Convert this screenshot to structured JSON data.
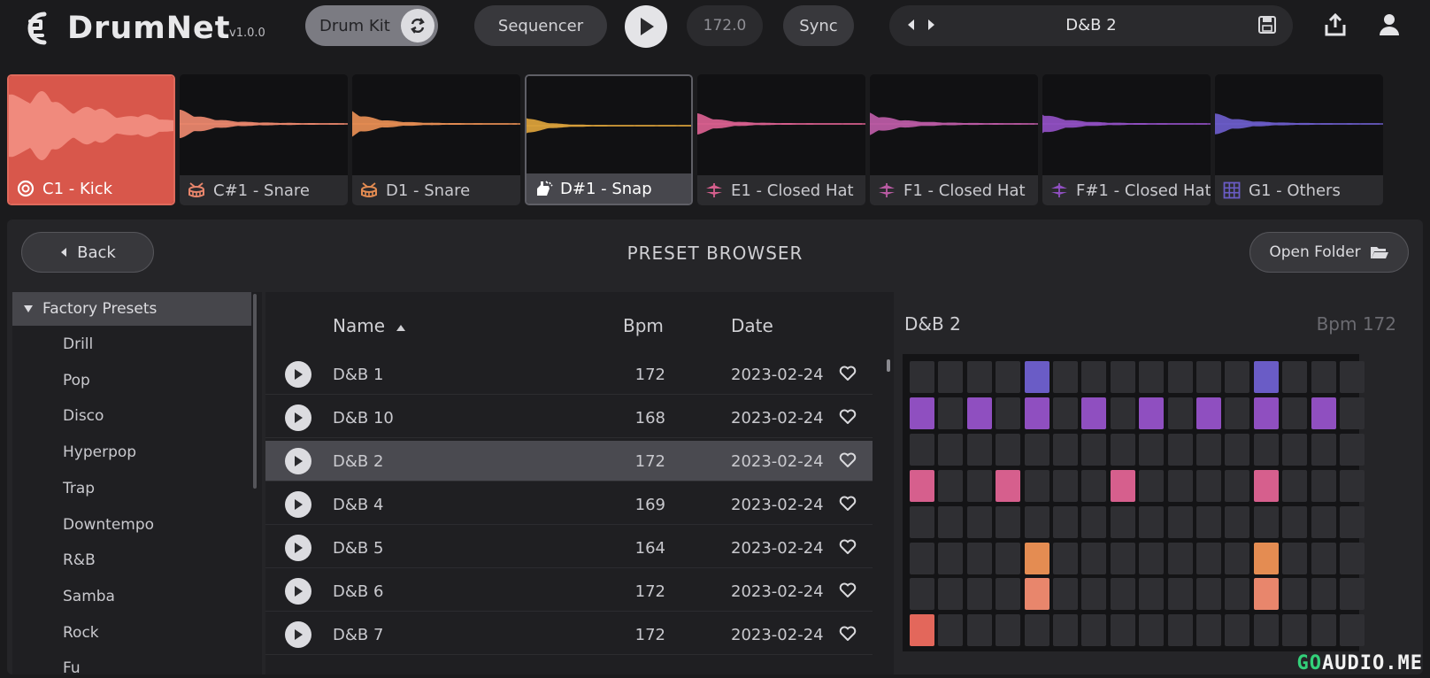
{
  "header": {
    "brand": "DrumNet",
    "version": "v1.0.0",
    "drum_kit_label": "Drum Kit",
    "sequencer_label": "Sequencer",
    "bpm": "172.0",
    "sync_label": "Sync",
    "preset_name": "D&B 2"
  },
  "pads": [
    {
      "label": "C1 - Kick",
      "color": "#e3675b",
      "icon": "kick-drum-icon",
      "state": "active"
    },
    {
      "label": "C#1 - Snare",
      "color": "#e8866c",
      "icon": "snare-drum-icon",
      "state": "normal"
    },
    {
      "label": "D1 - Snare",
      "color": "#e48c52",
      "icon": "snare-drum-icon",
      "state": "normal"
    },
    {
      "label": "D#1 - Snap",
      "color": "#d9a03a",
      "icon": "snap-hand-icon",
      "state": "selected"
    },
    {
      "label": "E1 - Closed Hat",
      "color": "#d65f8d",
      "icon": "hi-hat-icon",
      "state": "normal"
    },
    {
      "label": "F1 - Closed Hat",
      "color": "#b95ba3",
      "icon": "hi-hat-icon",
      "state": "normal"
    },
    {
      "label": "F#1 - Closed Hat",
      "color": "#8f4fc0",
      "icon": "hi-hat-icon",
      "state": "normal"
    },
    {
      "label": "G1 - Others",
      "color": "#6a5cc6",
      "icon": "grid-icon",
      "state": "normal"
    }
  ],
  "browser": {
    "back_label": "Back",
    "title": "PRESET BROWSER",
    "open_folder_label": "Open Folder"
  },
  "tree": {
    "root": "Factory Presets",
    "items": [
      "Drill",
      "Pop",
      "Disco",
      "Hyperpop",
      "Trap",
      "Downtempo",
      "R&B",
      "Samba",
      "Rock",
      "Fu"
    ]
  },
  "list": {
    "columns": {
      "name": "Name",
      "bpm": "Bpm",
      "date": "Date"
    },
    "sort": "name-ascending",
    "rows": [
      {
        "name": "D&B 1",
        "bpm": "172",
        "date": "2023-02-24",
        "selected": false
      },
      {
        "name": "D&B 10",
        "bpm": "168",
        "date": "2023-02-24",
        "selected": false
      },
      {
        "name": "D&B 2",
        "bpm": "172",
        "date": "2023-02-24",
        "selected": true
      },
      {
        "name": "D&B 4",
        "bpm": "169",
        "date": "2023-02-24",
        "selected": false
      },
      {
        "name": "D&B 5",
        "bpm": "164",
        "date": "2023-02-24",
        "selected": false
      },
      {
        "name": "D&B 6",
        "bpm": "172",
        "date": "2023-02-24",
        "selected": false
      },
      {
        "name": "D&B 7",
        "bpm": "172",
        "date": "2023-02-24",
        "selected": false
      }
    ]
  },
  "preview": {
    "title": "D&B 2",
    "bpm_text": "Bpm 172",
    "row_colors": [
      "#6a5cc6",
      "#8f4fc0",
      "#b95ba3",
      "#d65f8d",
      "#d9a03a",
      "#e48c52",
      "#e8866c",
      "#e3675b"
    ],
    "pattern": [
      [
        4,
        12
      ],
      [
        0,
        2,
        4,
        6,
        8,
        10,
        12,
        14
      ],
      [],
      [
        0,
        3,
        7,
        12
      ],
      [],
      [
        4,
        12
      ],
      [
        4,
        12
      ],
      [
        0
      ]
    ],
    "steps": 16
  },
  "watermark": {
    "prefix": "GO",
    "rest": "AUDIO.ME"
  }
}
